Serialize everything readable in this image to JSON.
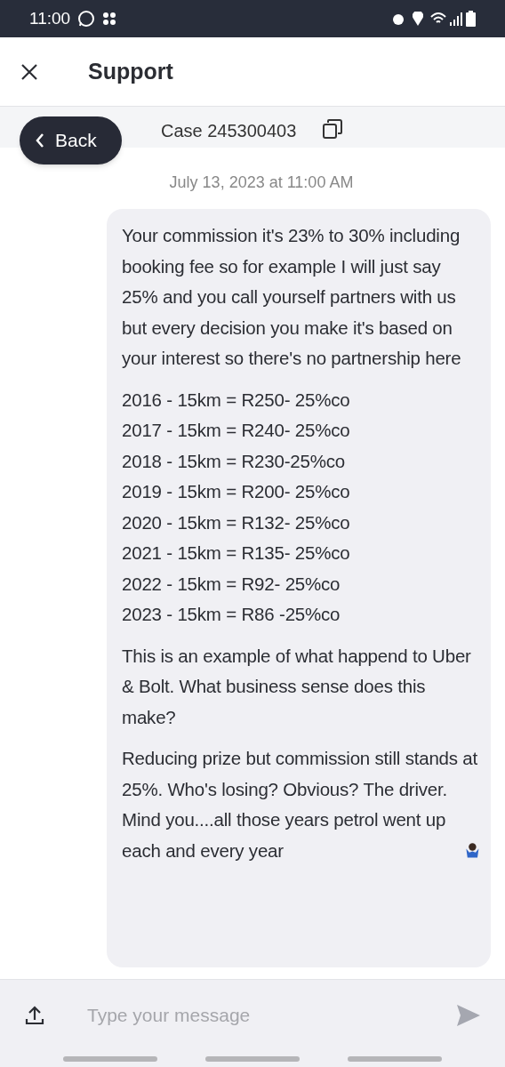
{
  "status_bar": {
    "time": "11:00"
  },
  "header": {
    "title": "Support"
  },
  "case_bar": {
    "back_label": "Back",
    "case": "Case 245300403"
  },
  "date": "July 13, 2023 at 11:00 AM",
  "message": {
    "paragraphs": [
      [
        "Your commission it's 23% to 30% including booking fee so for example I will just say 25% and you call yourself partners with us but every decision you make it's based on your interest so there's no partnership here"
      ],
      [
        "2016 - 15km = R250- 25%co",
        "2017 - 15km = R240- 25%co",
        "2018 - 15km = R230-25%co",
        "2019 - 15km = R200- 25%co",
        "2020 - 15km = R132- 25%co",
        "2021 - 15km = R135- 25%co",
        "2022 - 15km = R92- 25%co",
        "2023 - 15km = R86 -25%co"
      ],
      [
        "This is an example of what happend to Uber & Bolt. What business sense does this make?"
      ],
      [
        "Reducing prize but commission still stands at 25%. Who's losing? Obvious? The driver.",
        "Mind you....all those years petrol went up each and every year"
      ]
    ]
  },
  "composer": {
    "placeholder": "Type your message"
  }
}
